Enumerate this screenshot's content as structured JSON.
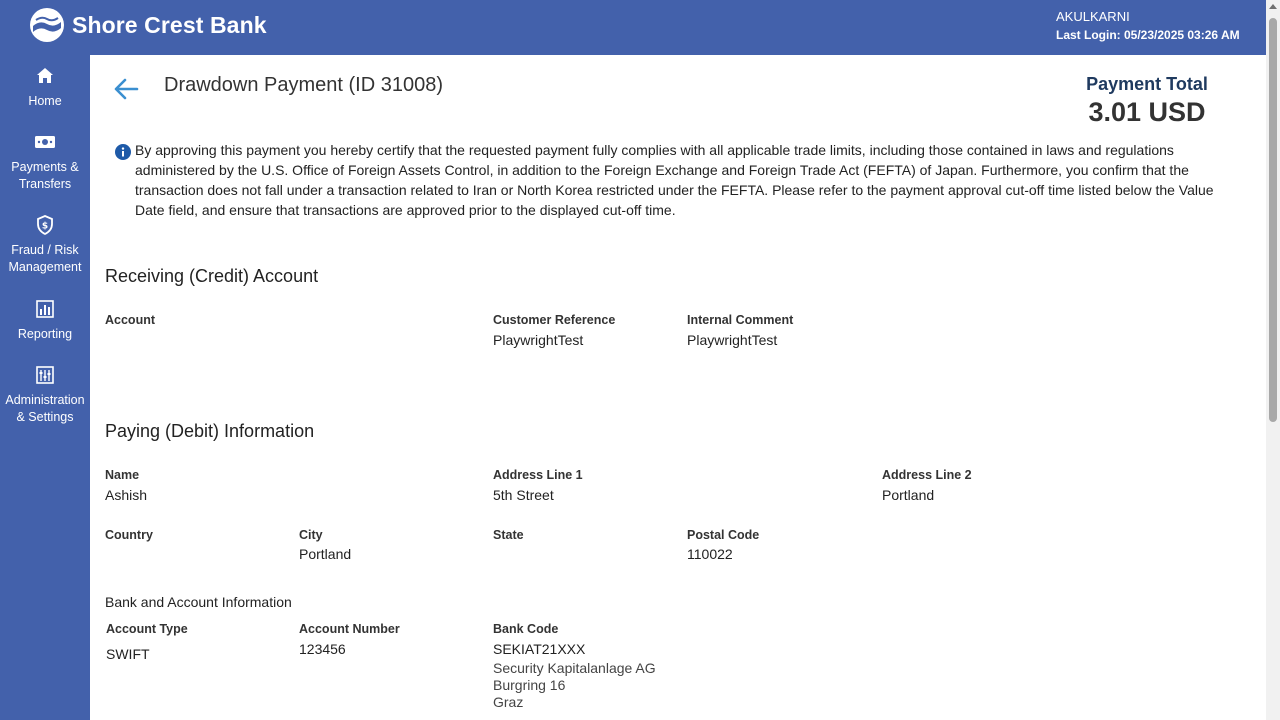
{
  "header": {
    "brand": "Shore Crest Bank",
    "user": "AKULKARNI",
    "last_login": "Last Login: 05/23/2025 03:26 AM",
    "bg_color": "#4361ab"
  },
  "sidebar": {
    "items": [
      {
        "label": "Home",
        "icon": "home-icon"
      },
      {
        "label": "Payments & Transfers",
        "icon": "payments-icon"
      },
      {
        "label": "Fraud / Risk Management",
        "icon": "shield-icon"
      },
      {
        "label": "Reporting",
        "icon": "bar-chart-icon"
      },
      {
        "label": "Administration & Settings",
        "icon": "settings-sliders-icon"
      }
    ]
  },
  "page": {
    "title": "Drawdown Payment (ID 31008)",
    "payment_total_label": "Payment Total",
    "payment_total_value": "3.01 USD",
    "disclaimer": "By approving this payment you hereby certify that the requested payment fully complies with all applicable trade limits, including those contained in laws and regulations administered by the U.S. Office of Foreign Assets Control, in addition to the Foreign Exchange and Foreign Trade Act (FEFTA) of Japan. Furthermore, you confirm that the transaction does not fall under a transaction related to Iran or North Korea restricted under the FEFTA. Please refer to the payment approval cut-off time listed below the Value Date field, and ensure that transactions are approved prior to the displayed cut-off time."
  },
  "receiving": {
    "title": "Receiving (Credit) Account",
    "account_label": "Account",
    "account_value": "",
    "customer_ref_label": "Customer Reference",
    "customer_ref_value": "PlaywrightTest",
    "internal_comment_label": "Internal Comment",
    "internal_comment_value": "PlaywrightTest"
  },
  "paying": {
    "title": "Paying (Debit) Information",
    "name_label": "Name",
    "name_value": "Ashish",
    "address1_label": "Address Line 1",
    "address1_value": "5th Street",
    "address2_label": "Address Line 2",
    "address2_value": "Portland",
    "country_label": "Country",
    "country_value": "",
    "city_label": "City",
    "city_value": "Portland",
    "state_label": "State",
    "state_value": "",
    "postal_label": "Postal Code",
    "postal_value": "110022"
  },
  "bank": {
    "title": "Bank and Account Information",
    "account_type_label": "Account Type",
    "account_type_value": "SWIFT",
    "account_number_label": "Account Number",
    "account_number_value": "123456",
    "bank_code_label": "Bank Code",
    "bank_code_value": "SEKIAT21XXX",
    "bank_name": "Security Kapitalanlage AG",
    "bank_street": "Burgring 16",
    "bank_city": "Graz"
  }
}
